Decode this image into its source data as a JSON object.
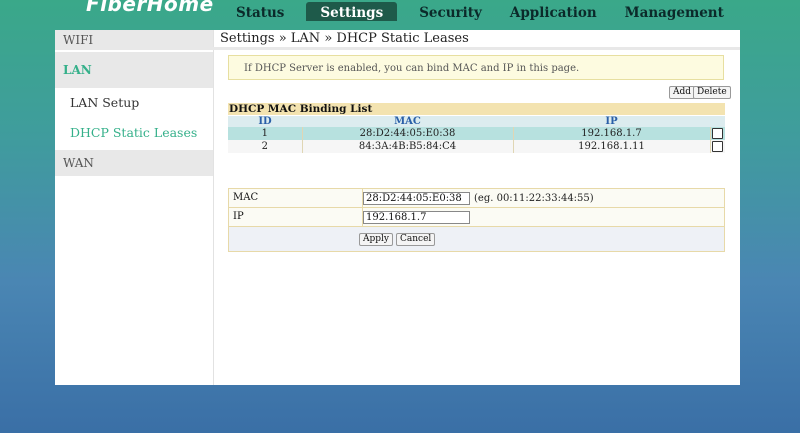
{
  "brand": "FiberHome",
  "nav": [
    "Status",
    "Settings",
    "Security",
    "Application",
    "Management"
  ],
  "sidebar": {
    "wifi": "WIFI",
    "lan": "LAN",
    "lan_setup": "LAN Setup",
    "dhcp_static": "DHCP Static Leases",
    "wan": "WAN"
  },
  "breadcrumb": "Settings » LAN » DHCP Static Leases",
  "info": "If DHCP Server is enabled, you can bind MAC and IP in this page.",
  "buttons": {
    "add": "Add",
    "delete": "Delete",
    "apply": "Apply",
    "cancel": "Cancel"
  },
  "list": {
    "title": "DHCP MAC Binding List",
    "headers": [
      "ID",
      "MAC",
      "IP"
    ],
    "rows": [
      {
        "id": "1",
        "mac": "28:D2:44:05:E0:38",
        "ip": "192.168.1.7"
      },
      {
        "id": "2",
        "mac": "84:3A:4B:B5:84:C4",
        "ip": "192.168.1.11"
      }
    ]
  },
  "form": {
    "mac_label": "MAC",
    "mac_value": "28:D2:44:05:E0:38",
    "mac_hint": "(eg. 00:11:22:33:44:55)",
    "ip_label": "IP",
    "ip_value": "192.168.1.7"
  }
}
